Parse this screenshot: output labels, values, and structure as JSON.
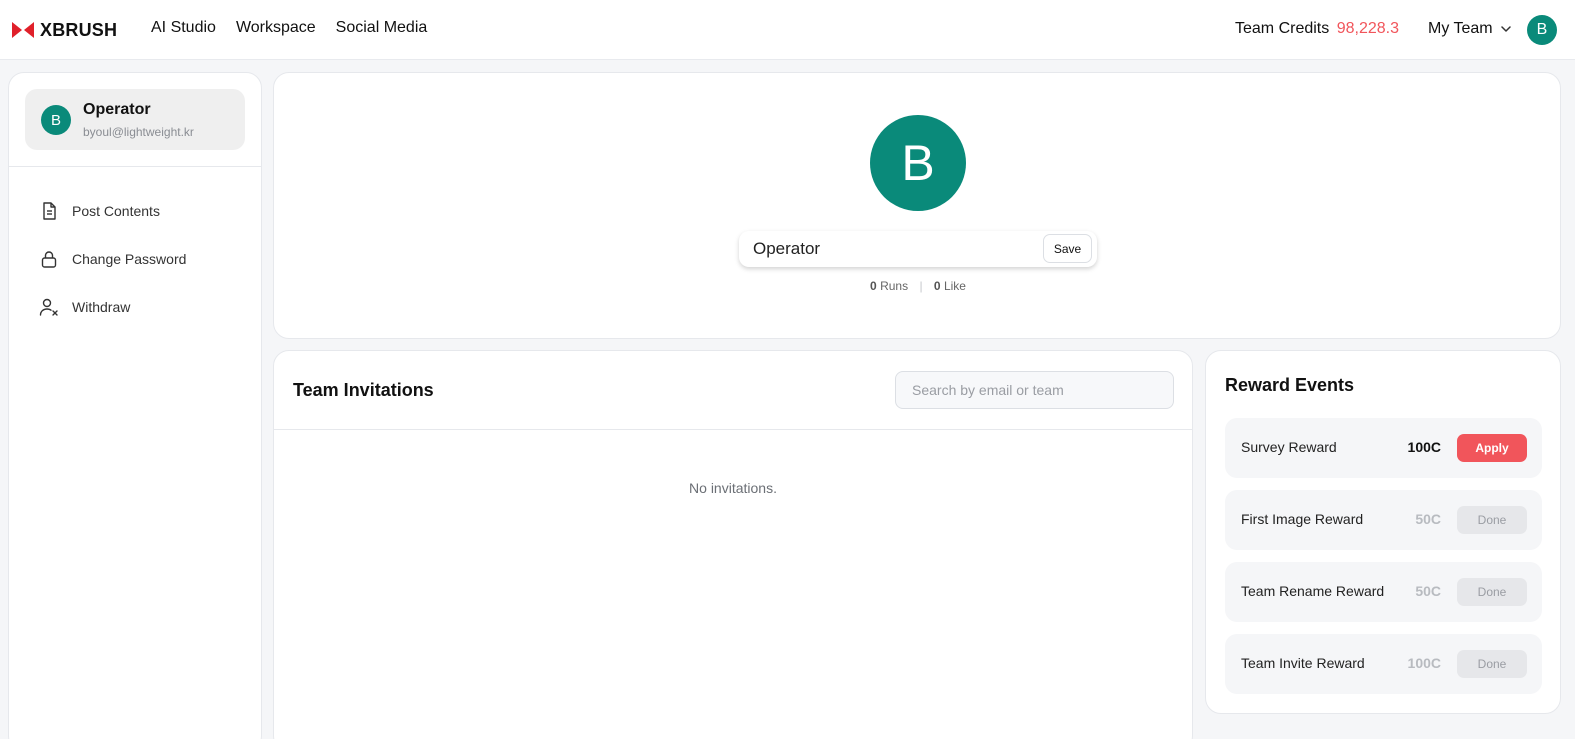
{
  "header": {
    "brand": "XBRUSH",
    "nav": [
      "AI Studio",
      "Workspace",
      "Social Media"
    ],
    "credits_label": "Team Credits",
    "credits_value": "98,228.3",
    "team_label": "My Team",
    "avatar_initial": "B"
  },
  "colors": {
    "brand_red": "#e0202a",
    "accent_red": "#f1555b",
    "avatar_teal": "#0a8a7a"
  },
  "sidebar": {
    "profile": {
      "initial": "B",
      "name": "Operator",
      "email": "byoul@lightweight.kr"
    },
    "items": [
      {
        "label": "Post Contents",
        "icon": "document-icon"
      },
      {
        "label": "Change Password",
        "icon": "lock-icon"
      },
      {
        "label": "Withdraw",
        "icon": "user-remove-icon"
      }
    ]
  },
  "profile": {
    "initial": "B",
    "name_value": "Operator",
    "save_label": "Save",
    "runs_count": "0",
    "runs_label": "Runs",
    "like_count": "0",
    "like_label": "Like"
  },
  "invitations": {
    "title": "Team Invitations",
    "search_placeholder": "Search by email or team",
    "empty_text": "No invitations."
  },
  "rewards": {
    "title": "Reward Events",
    "items": [
      {
        "name": "Survey Reward",
        "amount": "100C",
        "button": "Apply",
        "state": "active"
      },
      {
        "name": "First Image Reward",
        "amount": "50C",
        "button": "Done",
        "state": "done"
      },
      {
        "name": "Team Rename Reward",
        "amount": "50C",
        "button": "Done",
        "state": "done"
      },
      {
        "name": "Team Invite Reward",
        "amount": "100C",
        "button": "Done",
        "state": "done"
      }
    ]
  }
}
